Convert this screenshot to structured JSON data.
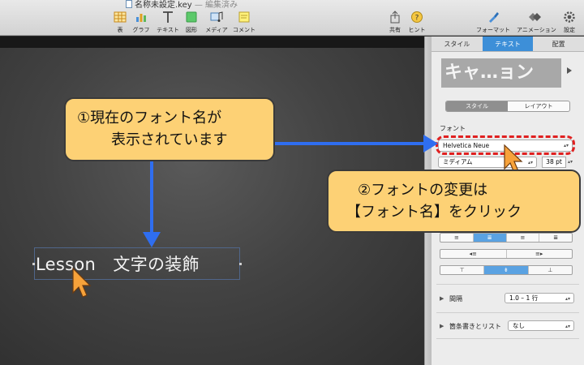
{
  "window": {
    "title": "名称未設定.key",
    "status": "— 編集済み"
  },
  "toolbar": {
    "left": [
      {
        "label": "表",
        "icon": "table-icon"
      },
      {
        "label": "グラフ",
        "icon": "chart-icon"
      },
      {
        "label": "テキスト",
        "icon": "text-icon"
      },
      {
        "label": "図形",
        "icon": "shape-icon"
      },
      {
        "label": "メディア",
        "icon": "media-icon"
      },
      {
        "label": "コメント",
        "icon": "comment-icon"
      }
    ],
    "right": [
      {
        "label": "共有",
        "icon": "share-icon"
      },
      {
        "label": "ヒント",
        "icon": "tips-icon"
      },
      {
        "label": "フォーマット",
        "icon": "format-icon"
      },
      {
        "label": "アニメーション",
        "icon": "animate-icon"
      },
      {
        "label": "設定",
        "icon": "gear-icon"
      }
    ]
  },
  "slide": {
    "text": "Lesson　文字の装飾"
  },
  "inspector": {
    "tabs": [
      "スタイル",
      "テキスト",
      "配置"
    ],
    "active_tab": "テキスト",
    "style_preview": "キャ…ョン",
    "segments": [
      "スタイル",
      "レイアウト"
    ],
    "font_section": "フォント",
    "font_name": "Helvetica Neue",
    "font_weight": "ミディアム",
    "font_size": "38 pt",
    "align_buttons": [
      "≡",
      "≣",
      "≡",
      "≣"
    ],
    "indent_buttons": [
      "◂≡",
      "≡▸"
    ],
    "valign_buttons": [
      "⊤",
      "⇟",
      "⊥"
    ],
    "spacing_label": "間隔",
    "spacing_value": "1.0 – 1 行",
    "bullets_label": "箇条書きとリスト",
    "bullets_value": "なし"
  },
  "callouts": {
    "one": {
      "line1": "①現在のフォント名が",
      "line2": "表示されています"
    },
    "two": {
      "line1": "②フォントの変更は",
      "line2": "【フォント名】をクリック"
    }
  },
  "colors": {
    "accent": "#3d8fd8",
    "callout": "#fdd175",
    "arrow": "#2f6ef0",
    "ring": "#e02020",
    "cursor": "#f7a23a"
  }
}
